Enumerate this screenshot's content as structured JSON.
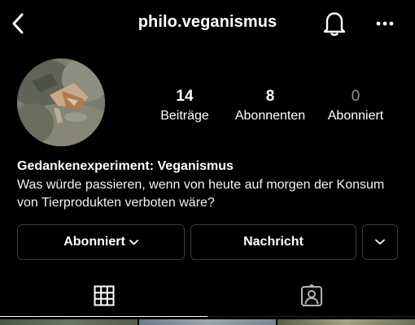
{
  "header": {
    "username": "philo.veganismus",
    "icons": {
      "back": "chevron-left-icon",
      "notifications": "bell-icon",
      "more": "more-horizontal-icon"
    }
  },
  "profile": {
    "stats": {
      "posts": {
        "value": "14",
        "label": "Beiträge"
      },
      "followers": {
        "value": "8",
        "label": "Abonnenten"
      },
      "following": {
        "value": "0",
        "label": "Abonniert"
      }
    },
    "bio": {
      "name": "Gedankenexperiment: Veganismus",
      "text": "Was würde passieren, wenn von heute auf morgen der Konsum von Tierprodukten verboten wäre?"
    }
  },
  "actions": {
    "follow_label": "Abonniert",
    "message_label": "Nachricht"
  },
  "tabs": [
    {
      "icon": "grid-icon",
      "selected": true
    },
    {
      "icon": "tagged-person-icon",
      "selected": false
    }
  ],
  "colors": {
    "background": "#000000",
    "text": "#ffffff",
    "muted": "#8e8e8e",
    "button_border": "#3b3b3b"
  }
}
